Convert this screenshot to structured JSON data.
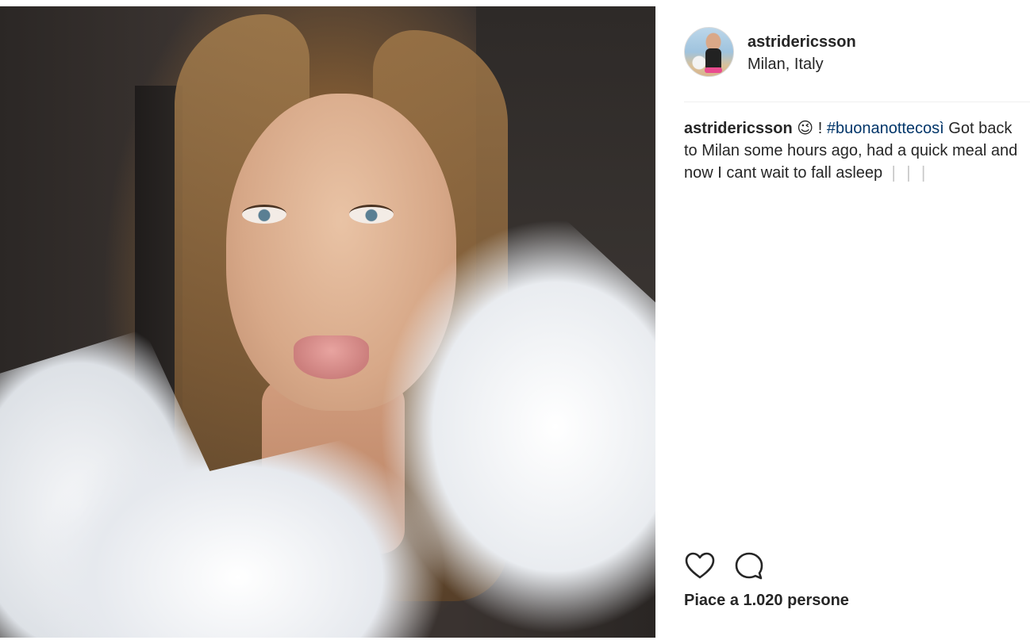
{
  "post": {
    "image_alt": "selfie photo",
    "header": {
      "username": "astridericsson",
      "location": "Milan, Italy"
    },
    "caption": {
      "username": "astridericsson",
      "emoji": "😉",
      "punct": " ! ",
      "hashtag": "#buonanottecosì",
      "text": " Got back to Milan some hours ago, had a quick meal and now I cant wait to fall asleep ",
      "trailing": "❘❘❘"
    },
    "actions": {
      "like_icon": "heart-icon",
      "comment_icon": "comment-icon"
    },
    "likes_text": "Piace a 1.020 persone"
  }
}
